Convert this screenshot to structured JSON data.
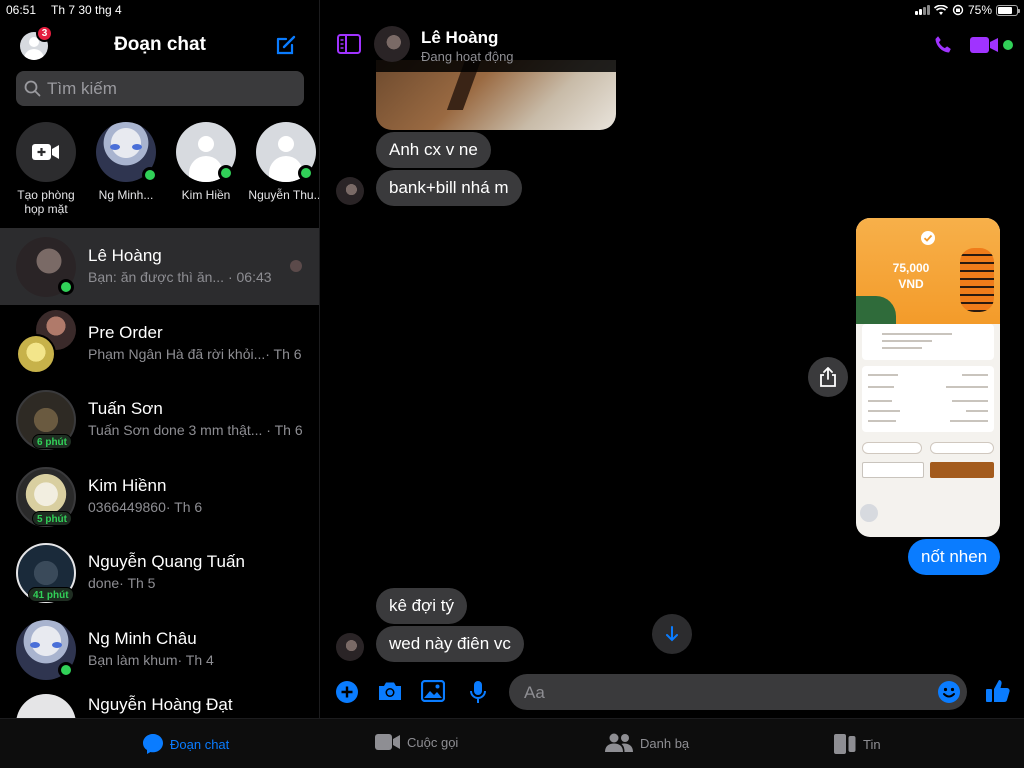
{
  "status_bar": {
    "time": "06:51",
    "date": "Th 7 30 thg 4",
    "battery": "75%",
    "battery_level": 0.75
  },
  "sidebar": {
    "title": "Đoạn chat",
    "badge_count": "3",
    "search_placeholder": "Tìm kiếm",
    "stories": [
      {
        "label": "Tạo phòng họp mặt"
      },
      {
        "label": "Ng Minh..."
      },
      {
        "label": "Kim Hiền"
      },
      {
        "label": "Nguyễn Thu..."
      }
    ],
    "conversations": [
      {
        "name": "Lê Hoàng",
        "preview": "Bạn: ăn được thì ăn... · 06:43"
      },
      {
        "name": "Pre Order",
        "preview": "Phạm Ngân Hà đã rời khỏi...· Th 6"
      },
      {
        "name": "Tuấn Sơn",
        "preview": "Tuấn Sơn done 3 mm thật... · Th 6",
        "badge": "6 phút"
      },
      {
        "name": "Kim Hiềnn",
        "preview": "0366449860· Th 6",
        "badge": "5 phút"
      },
      {
        "name": "Nguyễn Quang Tuấn",
        "preview": "done· Th 5",
        "badge": "41 phút"
      },
      {
        "name": "Ng Minh Châu",
        "preview": "Bạn làm khum· Th 4"
      },
      {
        "name": "Nguyễn Hoàng Đạt",
        "preview": ""
      }
    ]
  },
  "chat": {
    "contact_name": "Lê Hoàng",
    "contact_status": "Đang hoạt động",
    "messages": [
      {
        "text": "Anh cx v ne"
      },
      {
        "text": "bank+bill nhá m"
      },
      {
        "text": "nốt nhen"
      },
      {
        "text": "kê đợi tý"
      },
      {
        "text": "wed này điên vc"
      }
    ],
    "receipt": {
      "amount": "75,000",
      "currency": "VND"
    },
    "input_placeholder": "Aa"
  },
  "tabbar": {
    "tabs": [
      {
        "label": "Đoạn chat"
      },
      {
        "label": "Cuộc gọi"
      },
      {
        "label": "Danh bạ"
      },
      {
        "label": "Tin"
      }
    ]
  },
  "colors": {
    "accent": "#0a7cff",
    "header_accent": "#a033ff",
    "online": "#31d158"
  }
}
